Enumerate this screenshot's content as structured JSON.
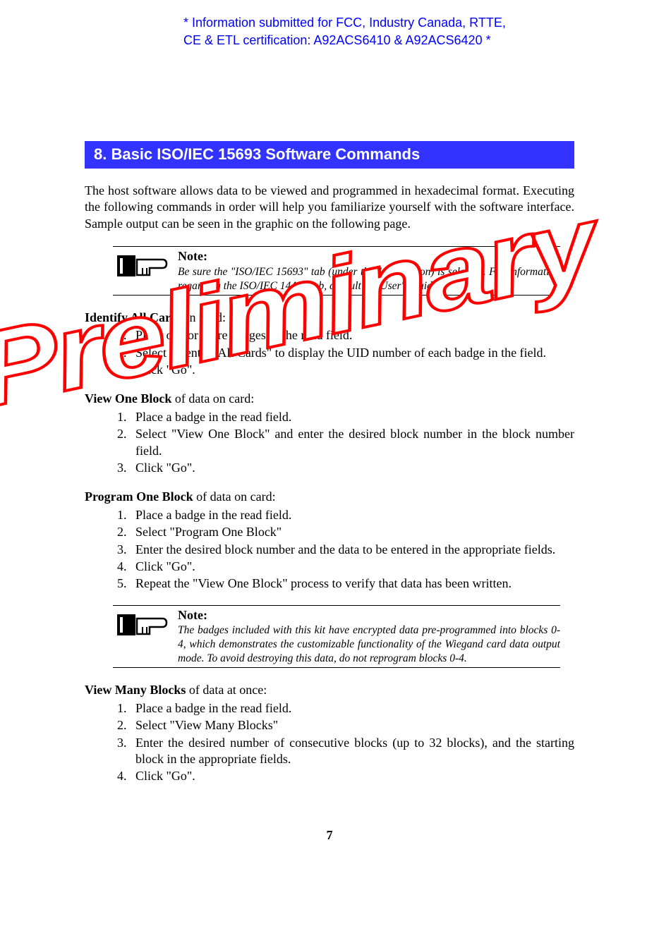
{
  "header_notice": "* Information submitted for FCC, Industry Canada, RTTE, CE & ETL certification: A92ACS6410 & A92ACS6420 *",
  "watermark_text": "Preliminary",
  "section_heading": "8. Basic ISO/IEC 15693 Software Commands",
  "intro": "The host software allows data to be viewed and programmed in hexadecimal format.  Executing the following commands in order will help you familiarize yourself with the software interface.  Sample output can be seen in the graphic on the following page.",
  "note1": {
    "label": "Note:",
    "text": "Be sure the \"ISO/IEC 15693\" tab (under the \"Go\" button) is selected. For information regarding the ISO/IEC 14443 tab, consult the User's Guide."
  },
  "identify": {
    "title": "Identify All Cards",
    "suffix": " in field:",
    "steps": [
      "Place one or more badges in the read field.",
      "Select \"Identify All Cards\" to display the UID number of each badge in the field.",
      "Click \"Go\"."
    ]
  },
  "view_one": {
    "title": "View One Block",
    "suffix": " of data on card:",
    "steps": [
      "Place a badge in the read field.",
      "Select \"View One Block\" and enter the desired block number in the block number field.",
      "Click \"Go\"."
    ]
  },
  "program_one": {
    "title": "Program One Block",
    "suffix": " of data on card:",
    "steps": [
      "Place a badge in the read field.",
      "Select \"Program One Block\"",
      "Enter the desired block number and the data to be entered in the appropriate fields.",
      "Click \"Go\".",
      "Repeat the \"View One Block\" process to verify that data has been written."
    ]
  },
  "note2": {
    "label": "Note:",
    "text": "The badges included with this kit have encrypted data pre-programmed into blocks 0-4, which demonstrates the customizable functionality of the Wiegand card data output mode.  To avoid destroying this data, do not reprogram blocks 0-4."
  },
  "view_many": {
    "title": "View Many Blocks",
    "suffix": " of data at once:",
    "steps": [
      "Place a badge in the read field.",
      "Select \"View Many Blocks\"",
      "Enter the desired number of consecutive blocks (up to 32 blocks), and the starting block in the appropriate fields.",
      "Click \"Go\"."
    ]
  },
  "page_number": "7"
}
